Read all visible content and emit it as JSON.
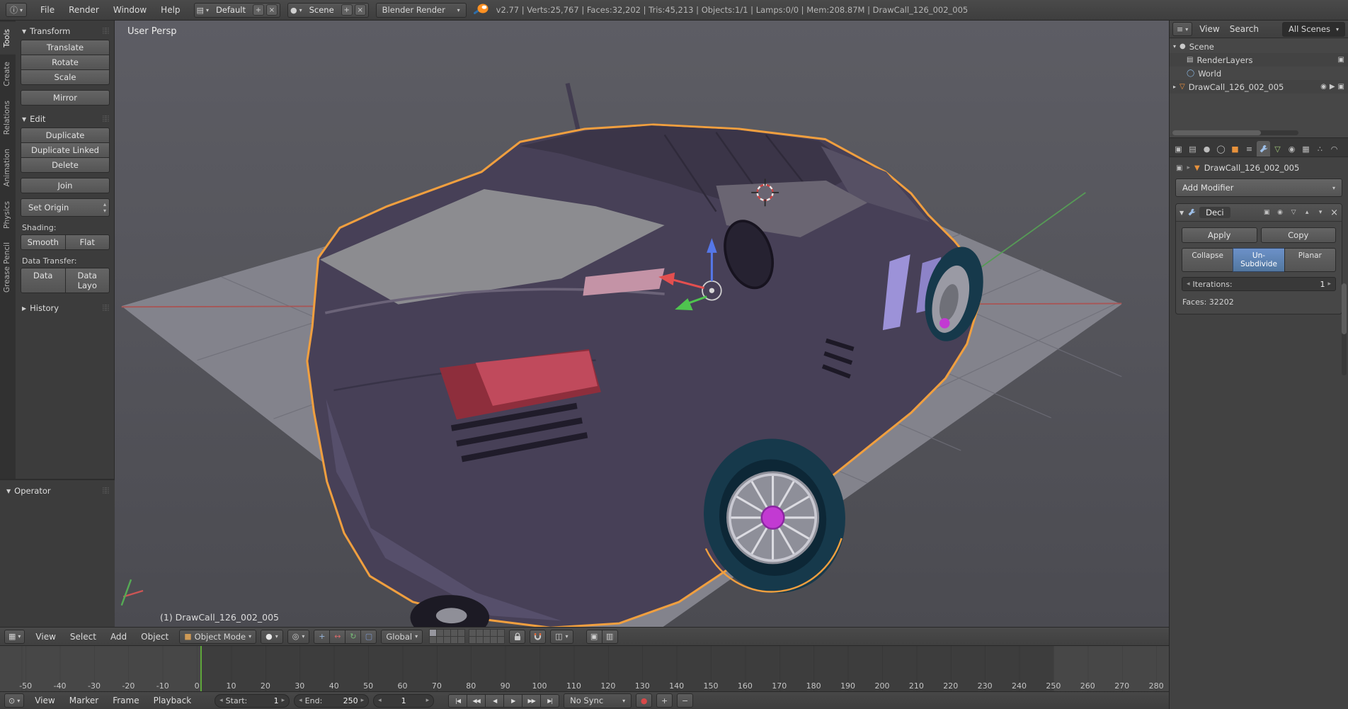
{
  "topbar": {
    "menus": [
      "File",
      "Render",
      "Window",
      "Help"
    ],
    "layout": "Default",
    "scene": "Scene",
    "engine": "Blender Render",
    "stats": "v2.77 | Verts:25,767 | Faces:32,202 | Tris:45,213 | Objects:1/1 | Lamps:0/0 | Mem:208.87M | DrawCall_126_002_005"
  },
  "toolshelf": {
    "tabs": [
      "Tools",
      "Create",
      "Relations",
      "Animation",
      "Physics",
      "Grease Pencil"
    ],
    "panels": {
      "transform": "Transform",
      "edit": "Edit",
      "history": "History",
      "operator": "Operator"
    },
    "transform_buttons": [
      "Translate",
      "Rotate",
      "Scale"
    ],
    "mirror_button": "Mirror",
    "edit_buttons": [
      "Duplicate",
      "Duplicate Linked",
      "Delete"
    ],
    "join_button": "Join",
    "set_origin_button": "Set Origin",
    "shading_label": "Shading:",
    "shading_buttons": [
      "Smooth",
      "Flat"
    ],
    "data_transfer_label": "Data Transfer:",
    "data_transfer_buttons": [
      "Data",
      "Data Layo"
    ]
  },
  "viewport": {
    "view_label": "User Persp",
    "object_label": "(1) DrawCall_126_002_005"
  },
  "view3d_header": {
    "menus": [
      "View",
      "Select",
      "Add",
      "Object"
    ],
    "mode": "Object Mode",
    "orientation": "Global"
  },
  "timeline": {
    "ticks": [
      "-50",
      "-40",
      "-30",
      "-20",
      "-10",
      "0",
      "10",
      "20",
      "30",
      "40",
      "50",
      "60",
      "70",
      "80",
      "90",
      "100",
      "110",
      "120",
      "130",
      "140",
      "150",
      "160",
      "170",
      "180",
      "190",
      "200",
      "210",
      "220",
      "230",
      "240",
      "250",
      "260",
      "270",
      "280"
    ],
    "menus": [
      "View",
      "Marker",
      "Frame",
      "Playback"
    ],
    "start_label": "Start:",
    "start_value": "1",
    "end_label": "End:",
    "end_value": "250",
    "frame_value": "1",
    "sync_mode": "No Sync"
  },
  "outliner": {
    "menus": [
      "View",
      "Search"
    ],
    "filter": "All Scenes",
    "scene": "Scene",
    "children": [
      "RenderLayers",
      "World"
    ],
    "object": "DrawCall_126_002_005"
  },
  "properties": {
    "breadcrumb_object": "DrawCall_126_002_005",
    "add_modifier_label": "Add Modifier",
    "modifier_name": "Deci",
    "apply_label": "Apply",
    "copy_label": "Copy",
    "decimate_modes": [
      "Collapse",
      "Un-Subdivide",
      "Planar"
    ],
    "active_mode": "Un-Subdivide",
    "iterations_label": "Iterations:",
    "iterations_value": "1",
    "faces_label": "Faces: 32202"
  },
  "colors": {
    "selection_outline": "#f09f3f",
    "active_blue": "#5c82b4",
    "current_frame_green": "#5ea63a",
    "object_accent_orange": "#e8923c"
  }
}
